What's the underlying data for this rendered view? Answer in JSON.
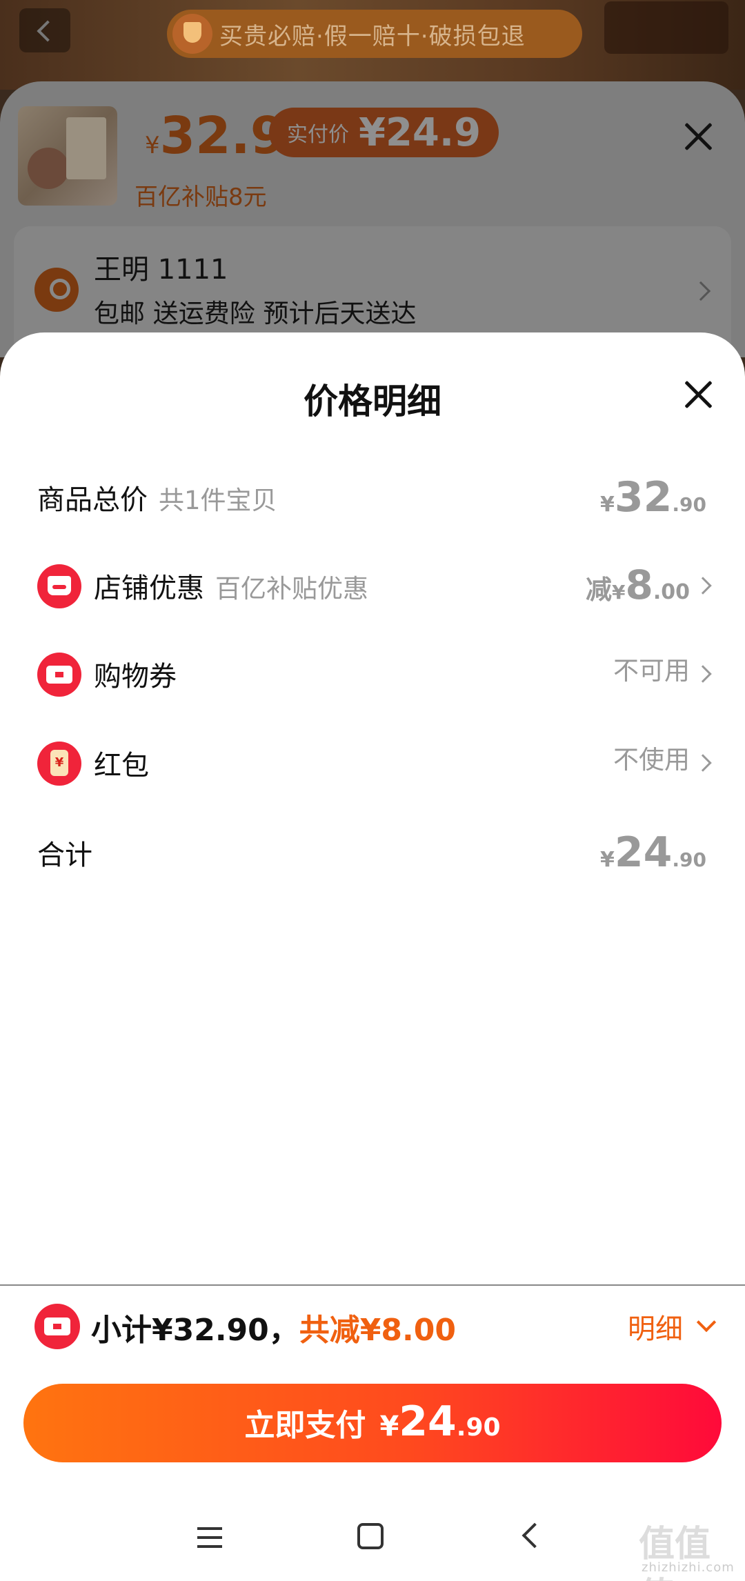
{
  "background_page": {
    "guarantee_text": "买贵必赔·假一赔十·破损包退"
  },
  "product": {
    "currency": "¥",
    "price": "32.9",
    "paid_label": "实付价",
    "paid_value": "¥24.9",
    "subsidy": "百亿补贴8元"
  },
  "address": {
    "name": "王明 1111",
    "shipping": "包邮 送运费险 预计后天送达"
  },
  "sheet": {
    "title": "价格明细",
    "rows": [
      {
        "label": "商品总价",
        "sub": "共1件宝贝",
        "currency": "¥",
        "int": "32",
        "dec": ".90"
      },
      {
        "label": "店铺优惠",
        "sub": "百亿补贴优惠",
        "prefix": "减",
        "currency": "¥",
        "int": "8",
        "dec": ".00"
      },
      {
        "label": "购物券",
        "value": "不可用"
      },
      {
        "label": "红包",
        "value": "不使用"
      },
      {
        "label": "合计",
        "currency": "¥",
        "int": "24",
        "dec": ".90"
      }
    ]
  },
  "bottom": {
    "subtotal": "小计¥32.90，",
    "discount": "共减¥8.00",
    "detail_toggle": "明细",
    "pay_label": "立即支付",
    "pay_currency": "¥",
    "pay_int": "24",
    "pay_dec": ".90"
  },
  "watermark": {
    "text": "值值值",
    "sub": "zhizhizhi.com"
  },
  "colors": {
    "accent_orange": "#f06010",
    "icon_red": "#f0243a",
    "pay_gradient_start": "#ff7410",
    "pay_gradient_end": "#ff0a3a"
  }
}
